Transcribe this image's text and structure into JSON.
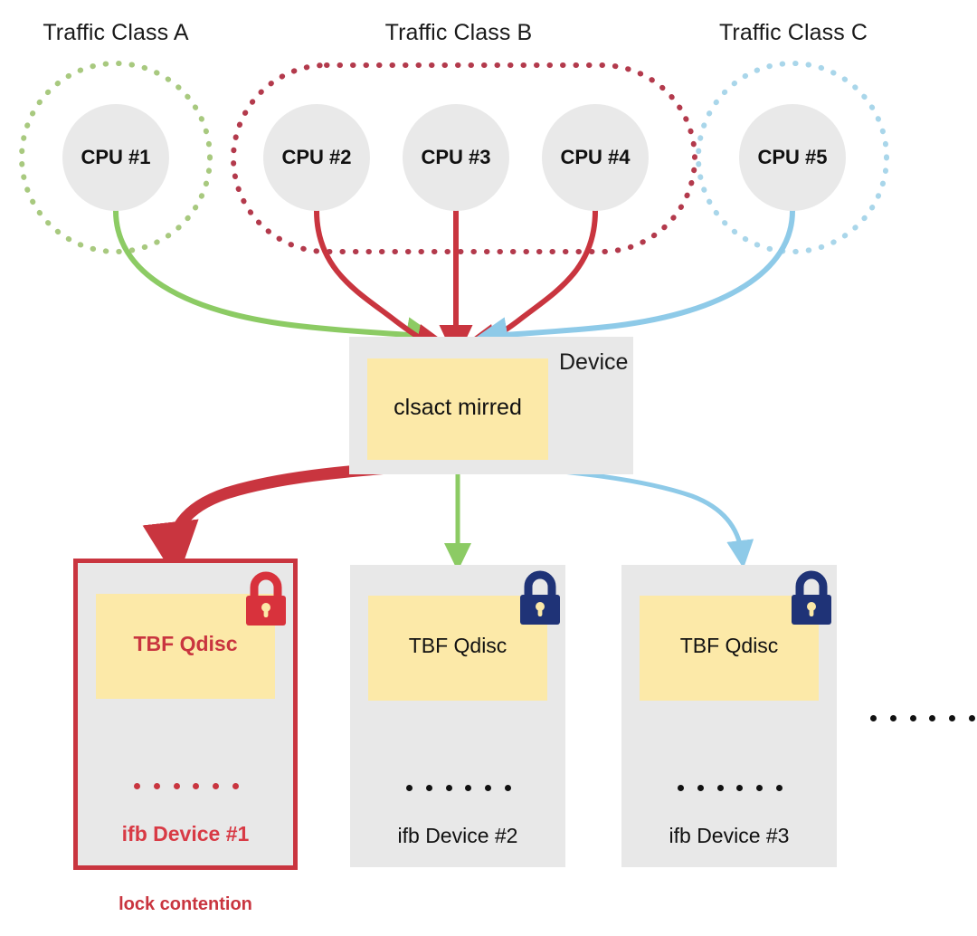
{
  "diagram": {
    "title_absent": true,
    "colors": {
      "red": "#c9353f",
      "green": "#8ccb64",
      "blue": "#8ecae8",
      "navy": "#1f3377",
      "yellow": "#fce9a8",
      "gray_box": "#e8e8e8",
      "cpu_gray": "#e9e9e9",
      "text": "#111111"
    },
    "traffic_classes": [
      {
        "id": "a",
        "label": "Traffic Class A",
        "color": "#a8c97f",
        "cpus": [
          "CPU #1"
        ]
      },
      {
        "id": "b",
        "label": "Traffic Class B",
        "color": "#b33a4c",
        "cpus": [
          "CPU #2",
          "CPU #3",
          "CPU #4"
        ]
      },
      {
        "id": "c",
        "label": "Traffic Class C",
        "color": "#a9d6ea",
        "cpus": [
          "CPU #5"
        ]
      }
    ],
    "cpus": [
      {
        "name": "CPU #1",
        "class": "Traffic Class A"
      },
      {
        "name": "CPU #2",
        "class": "Traffic Class B"
      },
      {
        "name": "CPU #3",
        "class": "Traffic Class B"
      },
      {
        "name": "CPU #4",
        "class": "Traffic Class B"
      },
      {
        "name": "CPU #5",
        "class": "Traffic Class C"
      }
    ],
    "device": {
      "label": "Device",
      "qdisc_label": "clsact mirred"
    },
    "ifb_devices": [
      {
        "qdisc_label": "TBF Qdisc",
        "device_label": "ifb Device #1",
        "lock_color": "#d8323c",
        "highlighted": true,
        "caption": "lock contention",
        "flow_color": "#c9353f",
        "ellipsis_dots": 6
      },
      {
        "qdisc_label": "TBF Qdisc",
        "device_label": "ifb Device #2",
        "lock_color": "#1f3377",
        "highlighted": false,
        "caption": "",
        "flow_color": "#8ccb64",
        "ellipsis_dots": 6
      },
      {
        "qdisc_label": "TBF Qdisc",
        "device_label": "ifb Device #3",
        "lock_color": "#1f3377",
        "highlighted": false,
        "caption": "",
        "flow_color": "#8ecae8",
        "ellipsis_dots": 6
      }
    ],
    "overflow_ellipsis_dots": 6,
    "flows": [
      {
        "from": "CPU #1",
        "to": "clsact mirred",
        "color": "#8ccb64"
      },
      {
        "from": "CPU #2",
        "to": "clsact mirred",
        "color": "#c9353f"
      },
      {
        "from": "CPU #3",
        "to": "clsact mirred",
        "color": "#c9353f"
      },
      {
        "from": "CPU #4",
        "to": "clsact mirred",
        "color": "#c9353f"
      },
      {
        "from": "CPU #5",
        "to": "clsact mirred",
        "color": "#8ecae8"
      },
      {
        "from": "clsact mirred",
        "to": "ifb Device #1",
        "color": "#c9353f"
      },
      {
        "from": "clsact mirred",
        "to": "ifb Device #2",
        "color": "#8ccb64"
      },
      {
        "from": "clsact mirred",
        "to": "ifb Device #3",
        "color": "#8ecae8"
      }
    ]
  }
}
